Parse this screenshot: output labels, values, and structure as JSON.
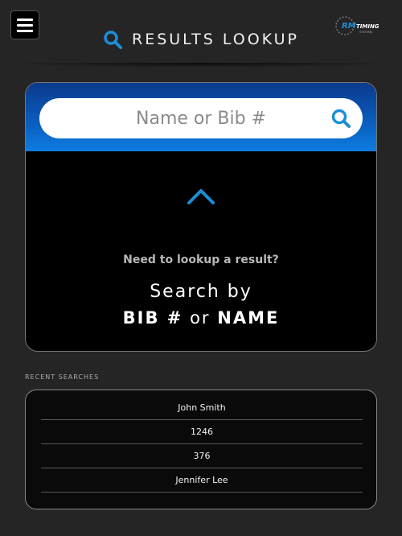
{
  "header": {
    "title": "RESULTS LOOKUP",
    "logo_brand": "RM",
    "logo_text": "TIMING",
    "logo_sub": "SYSTEMS"
  },
  "search": {
    "placeholder": "Name or Bib #"
  },
  "prompt": {
    "question": "Need to lookup a result?",
    "search_by": "Search by",
    "bib": "BIB #",
    "or": "or",
    "name": "NAME"
  },
  "recent": {
    "label": "RECENT SEARCHES",
    "items": [
      "John Smith",
      "1246",
      "376",
      "Jennifer Lee"
    ]
  },
  "colors": {
    "accent": "#1a8fd8",
    "background": "#252525"
  }
}
